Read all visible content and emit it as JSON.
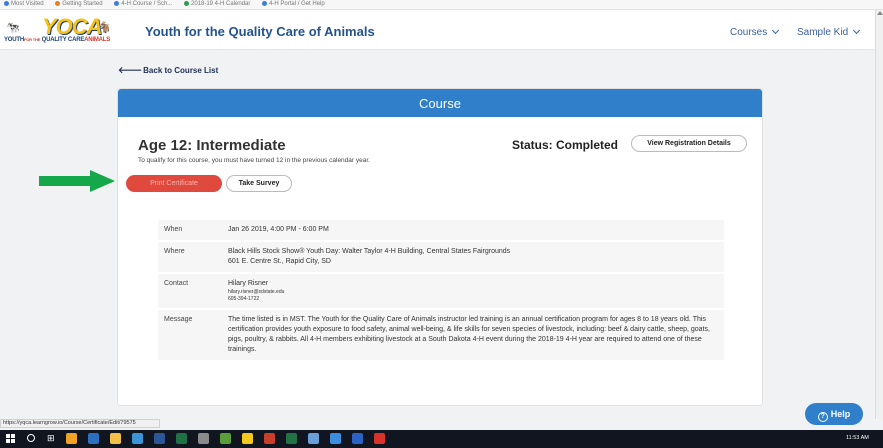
{
  "browser": {
    "bookmarks": [
      "Most Visited",
      "Getting Started",
      "4-H Course / Sch...",
      "2018-19 4-H Calendar",
      "4-H Portal / Get Help"
    ],
    "status_url": "https://yqca.learngrow.io/Course/Certificate/Edit/79575"
  },
  "header": {
    "logo_text": "YOCA",
    "logo_subtitle_left": "YOUTH",
    "logo_subtitle_mid": "FOR THE",
    "logo_subtitle_right": "QUALITY CARE",
    "logo_subtitle_end": "ANIMALS",
    "site_title": "Youth for the Quality Care of Animals",
    "nav_courses": "Courses",
    "nav_user": "Sample Kid"
  },
  "back_link": "Back to Course List",
  "card": {
    "heading": "Course",
    "course_title": "Age 12: Intermediate",
    "course_note": "To qualify for this course, you must have turned 12 in the previous calendar year.",
    "status": "Status: Completed",
    "view_registration_label": "View Registration Details",
    "print_certificate_label": "Print Certificate",
    "take_survey_label": "Take Survey",
    "details": {
      "when_label": "When",
      "when_value": "Jan 26 2019, 4:00 PM - 6:00 PM",
      "where_label": "Where",
      "where_line1": "Black Hills Stock Show® Youth Day: Walter Taylor 4-H Building, Central States Fairgrounds",
      "where_line2": "601 E. Centre St., Rapid City, SD",
      "contact_label": "Contact",
      "contact_name": "Hilary Risner",
      "contact_email": "hilary.risner@sdstate.edu",
      "contact_phone": "605-394-1722",
      "message_label": "Message",
      "message_value": "The time listed is in MST. The Youth for the Quality Care of Animals instructor led training is an annual certification program for ages 8 to 18 years old. This certification provides youth exposure to food safety, animal well-being, & life skills for seven species of livestock, including: beef & dairy cattle, sheep, goats, pigs, poultry, & rabbits. All 4-H members exhibiting livestock at a South Dakota 4-H event during the 2018-19 4-H year are required to attend one of these trainings."
    }
  },
  "help_label": "Help",
  "taskbar": {
    "clock": "11:53 AM",
    "task_view_glyph": "⊞"
  },
  "colors": {
    "brand_blue": "#2f7fcb",
    "print_red": "#e04a3e",
    "annotation_green": "#15a84a",
    "title_blue": "#23538f"
  }
}
